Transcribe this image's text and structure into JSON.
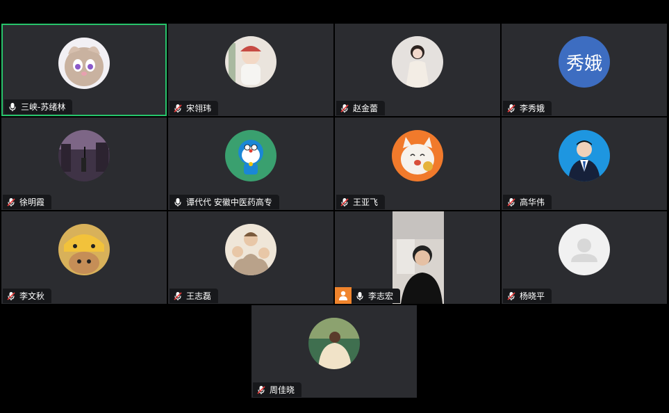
{
  "meeting": {
    "participants": [
      {
        "name": "三峡-苏绪林",
        "mic": "active"
      },
      {
        "name": "宋翎玮",
        "mic": "muted"
      },
      {
        "name": "赵金蕾",
        "mic": "muted"
      },
      {
        "name": "李秀娥",
        "mic": "muted",
        "initials": "秀娥"
      },
      {
        "name": "徐明霞",
        "mic": "muted"
      },
      {
        "name": "谭代代 安徽中医药高专",
        "mic": "active"
      },
      {
        "name": "王亚飞",
        "mic": "muted"
      },
      {
        "name": "高华伟",
        "mic": "muted"
      },
      {
        "name": "李文秋",
        "mic": "muted"
      },
      {
        "name": "王志磊",
        "mic": "muted"
      },
      {
        "name": "李志宏",
        "mic": "active"
      },
      {
        "name": "杨晓平",
        "mic": "muted"
      },
      {
        "name": "周佳晓",
        "mic": "muted"
      }
    ]
  },
  "colors": {
    "active_border": "#27c46b",
    "tile_bg": "#2b2c30",
    "label_bg": "#17181b",
    "mic_active": "#ffffff",
    "mic_muted": "#e33b3b",
    "initials_bg": "#3d6dc1",
    "video_badge": "#f0842c"
  }
}
